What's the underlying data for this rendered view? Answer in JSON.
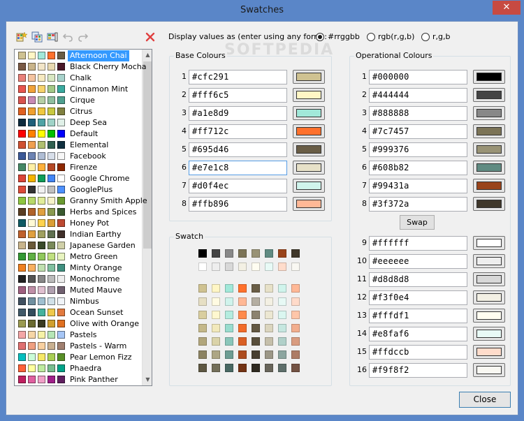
{
  "window": {
    "title": "Swatches",
    "close_glyph": "✕"
  },
  "toolbar": {
    "icons": [
      "new-swatch-icon",
      "copy-swatch-icon",
      "rename-swatch-icon",
      "undo-icon",
      "redo-icon",
      "delete-icon"
    ],
    "colors": {
      "delete": "#e04040",
      "disabled": "#b0b0b0"
    }
  },
  "list": {
    "selected_index": 0,
    "items": [
      {
        "name": "Afternoon Chai",
        "colors": [
          "#cfc291",
          "#fff6c5",
          "#a1e8d9",
          "#ff712c",
          "#695d46"
        ]
      },
      {
        "name": "Black Cherry Mocha",
        "colors": [
          "#7a5a45",
          "#c9b48a",
          "#f2e5c8",
          "#e8d8b0",
          "#4a1a2a"
        ]
      },
      {
        "name": "Chalk",
        "colors": [
          "#e9817a",
          "#f4c3a0",
          "#f6e9c0",
          "#d8e7c2",
          "#a7d2cb"
        ]
      },
      {
        "name": "Cinnamon Mint",
        "colors": [
          "#e8554e",
          "#f2a33a",
          "#f7d36b",
          "#a3c987",
          "#3aaa9f"
        ]
      },
      {
        "name": "Cirque",
        "colors": [
          "#d9534f",
          "#c88bb5",
          "#b5cfa5",
          "#8fbf9f",
          "#4f9f8f"
        ]
      },
      {
        "name": "Citrus",
        "colors": [
          "#e06020",
          "#f0a030",
          "#f0c840",
          "#c8c840",
          "#808040"
        ]
      },
      {
        "name": "Deep Sea",
        "colors": [
          "#0d2b3e",
          "#1f5f7a",
          "#4fa3a5",
          "#9fd3c7",
          "#e0f0e8"
        ]
      },
      {
        "name": "Default",
        "colors": [
          "#ff0000",
          "#ff8000",
          "#ffff00",
          "#00c000",
          "#0000ff"
        ]
      },
      {
        "name": "Elemental",
        "colors": [
          "#d05030",
          "#f0a050",
          "#b0c070",
          "#306050",
          "#103040"
        ]
      },
      {
        "name": "Facebook",
        "colors": [
          "#3b5998",
          "#6d84b4",
          "#afbdd4",
          "#d8dfea",
          "#f7f7f7"
        ]
      },
      {
        "name": "Firenze",
        "colors": [
          "#468966",
          "#fff0a5",
          "#ffb03b",
          "#b64926",
          "#8e2800"
        ]
      },
      {
        "name": "Google Chrome",
        "colors": [
          "#db4437",
          "#f4b400",
          "#0f9d58",
          "#4285f4",
          "#ffffff"
        ]
      },
      {
        "name": "GooglePlus",
        "colors": [
          "#dd4b39",
          "#333333",
          "#f1f1f1",
          "#c0c0c0",
          "#4d90fe"
        ]
      },
      {
        "name": "Granny Smith Apple",
        "colors": [
          "#8fc640",
          "#b8d96a",
          "#e1ed9a",
          "#f6f3c9",
          "#6a9a30"
        ]
      },
      {
        "name": "Herbs and Spices",
        "colors": [
          "#5a3d22",
          "#b0622a",
          "#e0a040",
          "#8a9a50",
          "#3a5a30"
        ]
      },
      {
        "name": "Honey Pot",
        "colors": [
          "#105b63",
          "#fffad5",
          "#ffd34e",
          "#db9e36",
          "#bd4932"
        ]
      },
      {
        "name": "Indian Earthy",
        "colors": [
          "#c0612c",
          "#e0a040",
          "#a0a060",
          "#607050",
          "#40302a"
        ]
      },
      {
        "name": "Japanese Garden",
        "colors": [
          "#c8b48c",
          "#6a5a3a",
          "#3a4a2a",
          "#7a8a5a",
          "#d0d0a8"
        ]
      },
      {
        "name": "Metro Green",
        "colors": [
          "#339933",
          "#60b044",
          "#90c85c",
          "#c0e080",
          "#e8f4c0"
        ]
      },
      {
        "name": "Minty Orange",
        "colors": [
          "#f08020",
          "#f8b060",
          "#c0e0b0",
          "#80c0a0",
          "#409080"
        ]
      },
      {
        "name": "Monochrome",
        "colors": [
          "#222222",
          "#555555",
          "#888888",
          "#bbbbbb",
          "#eeeeee"
        ]
      },
      {
        "name": "Muted Mauve",
        "colors": [
          "#a06080",
          "#c090a8",
          "#e0c0d0",
          "#b0a0b0",
          "#706070"
        ]
      },
      {
        "name": "Nimbus",
        "colors": [
          "#405060",
          "#7090a0",
          "#a0c0d0",
          "#d0e0e8",
          "#f0f4f8"
        ]
      },
      {
        "name": "Ocean Sunset",
        "colors": [
          "#405968",
          "#334d5c",
          "#45b29d",
          "#efc94c",
          "#e27a3f"
        ]
      },
      {
        "name": "Olive with Orange",
        "colors": [
          "#9a9a50",
          "#6a6a30",
          "#3a3a20",
          "#d0a030",
          "#e07020"
        ]
      },
      {
        "name": "Pastels",
        "colors": [
          "#f4a6a6",
          "#f6d6a6",
          "#f6f2a6",
          "#b6e6b6",
          "#a6c6f6"
        ]
      },
      {
        "name": "Pastels - Warm",
        "colors": [
          "#e07070",
          "#f0a080",
          "#f8d0a0",
          "#c8b090",
          "#a08070"
        ]
      },
      {
        "name": "Pear Lemon Fizz",
        "colors": [
          "#04bfbf",
          "#cafcd8",
          "#f7e967",
          "#a9cf54",
          "#588f27"
        ]
      },
      {
        "name": "Phaedra",
        "colors": [
          "#ff6138",
          "#ffff9d",
          "#beeb9f",
          "#79bd8f",
          "#00a388"
        ]
      },
      {
        "name": "Pink Panther",
        "colors": [
          "#c02060",
          "#e060a0",
          "#f0a0c8",
          "#a0208a",
          "#602060"
        ]
      }
    ]
  },
  "display": {
    "label": "Display values as (enter using any form):",
    "options": [
      "#rrggbb",
      "rgb(r,g,b)",
      "r,g,b"
    ],
    "selected": 0
  },
  "watermark": "SOFTPEDIA",
  "base": {
    "title": "Base Colours",
    "rows": [
      {
        "num": "1",
        "hex": "#cfc291"
      },
      {
        "num": "2",
        "hex": "#fff6c5"
      },
      {
        "num": "3",
        "hex": "#a1e8d9"
      },
      {
        "num": "4",
        "hex": "#ff712c"
      },
      {
        "num": "5",
        "hex": "#695d46"
      },
      {
        "num": "6",
        "hex": "#e7e1c8"
      },
      {
        "num": "7",
        "hex": "#d0f4ec"
      },
      {
        "num": "8",
        "hex": "#ffb896"
      }
    ]
  },
  "operational": {
    "title": "Operational Colours",
    "swap_label": "Swap",
    "rows": [
      {
        "num": "1",
        "hex": "#000000"
      },
      {
        "num": "2",
        "hex": "#444444"
      },
      {
        "num": "3",
        "hex": "#888888"
      },
      {
        "num": "4",
        "hex": "#7c7457"
      },
      {
        "num": "5",
        "hex": "#999376"
      },
      {
        "num": "6",
        "hex": "#608b82"
      },
      {
        "num": "7",
        "hex": "#99431a"
      },
      {
        "num": "8",
        "hex": "#3f372a"
      }
    ],
    "rows2": [
      {
        "num": "9",
        "hex": "#ffffff"
      },
      {
        "num": "10",
        "hex": "#eeeeee"
      },
      {
        "num": "11",
        "hex": "#d8d8d8"
      },
      {
        "num": "12",
        "hex": "#f3f0e4"
      },
      {
        "num": "13",
        "hex": "#fffdf1"
      },
      {
        "num": "14",
        "hex": "#e8faf6"
      },
      {
        "num": "15",
        "hex": "#ffdccb"
      },
      {
        "num": "16",
        "hex": "#f9f8f2"
      }
    ]
  },
  "swatch": {
    "title": "Swatch",
    "top_rows": [
      [
        "#000000",
        "#444444",
        "#888888",
        "#7c7457",
        "#999376",
        "#608b82",
        "#99431a",
        "#3f372a"
      ],
      [
        "#ffffff",
        "#eeeeee",
        "#d8d8d8",
        "#f3f0e4",
        "#fffdf1",
        "#e8faf6",
        "#ffdccb",
        "#f9f8f2"
      ]
    ],
    "grid_rows": [
      [
        "#cfc291",
        "#fff6c5",
        "#a1e8d9",
        "#ff712c",
        "#695d46",
        "#e7e1c8",
        "#d0f4ec",
        "#ffb896"
      ],
      [
        "#e6dfc4",
        "#fffbe2",
        "#d0f3ec",
        "#ffb895",
        "#b4aea2",
        "#f3f0e3",
        "#e7f9f5",
        "#ffdbca"
      ],
      [
        "#d9ce9f",
        "#fff8cf",
        "#b4ecdf",
        "#ff8a4c",
        "#8b826f",
        "#ece7d2",
        "#daf6f0",
        "#ffc6a9"
      ],
      [
        "#c4b889",
        "#f2e9bb",
        "#99dcce",
        "#f26b29",
        "#635842",
        "#dbd5be",
        "#c6e7e0",
        "#f2ae8e"
      ],
      [
        "#b1a67c",
        "#dad3a9",
        "#8ac6ba",
        "#d96025",
        "#594f3c",
        "#c5bfaa",
        "#b1d0c9",
        "#d99c80"
      ],
      [
        "#8c8362",
        "#ada685",
        "#6d9d93",
        "#ad4c1e",
        "#473f30",
        "#9c9787",
        "#8ca59f",
        "#ad7c65"
      ],
      [
        "#5d5741",
        "#736f59",
        "#486862",
        "#733314",
        "#2f2a20",
        "#68655a",
        "#5d6e6a",
        "#735243"
      ]
    ]
  }
}
